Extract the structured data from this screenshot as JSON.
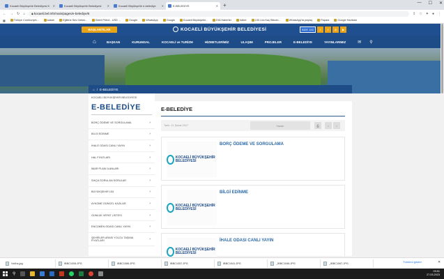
{
  "browser": {
    "tabs": [
      {
        "label": "Kocaeli Büyükşehir Belediyesi K",
        "active": false
      },
      {
        "label": "Kocaeli Büyükşehir Belediyesi",
        "active": false
      },
      {
        "label": "Kocaeli Büyükşehir e-belediye",
        "active": false
      },
      {
        "label": "E-BELEDİYE",
        "active": true
      }
    ],
    "new_tab": "+",
    "url": "kocaeli.bel.tr/tr/main/pages/e-belediye/6",
    "bookmarks": [
      "Türkiye Cumhuriyet...",
      "sabah",
      "Eğitime Ses Gelsin...",
      "Brent Petrol - USD ...",
      "Google",
      "WhatsApp",
      "Google",
      "Kocaeli Büyükşehir...",
      "İHA Haberler",
      "haber",
      "100 Lira Kaç Bitcoin...",
      "WhatsApp'ta paylaş",
      "Papara",
      "Google Haritalar"
    ]
  },
  "site": {
    "emergency_button": "BAŞLANTILAR",
    "logo_text": "KOCAELİ BÜYÜKŞEHİR BELEDİYESİ",
    "badge_text": "BİZE 153",
    "nav": [
      "BAŞKAN",
      "KURUMSAL",
      "KOCAELİ ve TURİZM",
      "HİZMETLERİMİZ",
      "ULAŞIM",
      "PROJELER",
      "E-BELEDİYE",
      "YAYINLARIMIZ"
    ],
    "breadcrumb": "E-BELEDİYE",
    "sidebar": {
      "crumb": "KOCAELİ BÜYÜKŞEHİR BELEDİYESİ",
      "title": "E-BELEDİYE",
      "items": [
        "BORÇ ÖDEME VE SORGULAMA",
        "BİLGİ EDİNME",
        "İHALE ODASI CANLI YAYIN",
        "HAL FİYATLARI",
        "İMAR PLANI İLANLARI",
        "SIKÇA SORULAN SORULAR",
        "BÜYÜKŞEHİR 153",
        "AYKOME GÜNCEL KAZILAR",
        "GÜNLÜK VEFAT LİSTESİ",
        "ENCÜMEN ODASI CANLI YAYIN",
        "ŞEHİRLER ARASI YOLCU TAŞIMA FİYATLARI"
      ]
    },
    "content": {
      "title": "E-BELEDİYE",
      "date": "Tarih: 21 Şubat 2017",
      "print_label": "Yazdır",
      "cards": [
        {
          "title": "BORÇ ÖDEME VE SORGULAMA",
          "logo": "KOCAELİ BÜYÜKŞEHİR BELEDİYESİ"
        },
        {
          "title": "BİLGİ EDİNME",
          "logo": "KOCAELİ BÜYÜKŞEHİR BELEDİYESİ"
        },
        {
          "title": "İHALE ODASI CANLI YAYIN",
          "logo": "KOCAELİ BÜYÜKŞEHİR BELEDİYESİ"
        }
      ]
    }
  },
  "downloads": {
    "items": [
      "Vs4hs.jpg",
      "IBBC1006.JPG",
      "IBBC1086.JPG",
      "IBBC1057.JPG",
      "IBBC1041.JPG",
      "_IBBC1046.JPG",
      "_IBBC1067.JPG"
    ],
    "show_all": "Tümünü göster"
  },
  "taskbar": {
    "time": "09:51",
    "date": "27.03.2023"
  }
}
